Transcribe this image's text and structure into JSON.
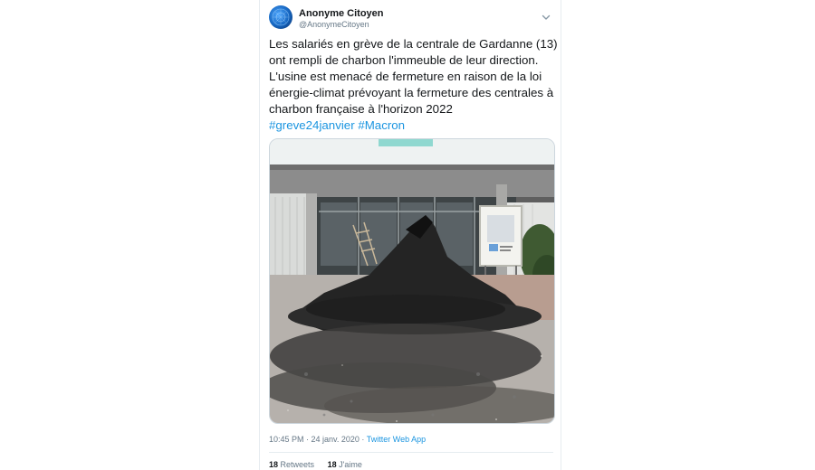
{
  "tweet": {
    "author_name": "Anonyme Citoyen",
    "author_handle": "@AnonymeCitoyen",
    "text_lines": [
      "Les salariés en grève de la centrale de Gardanne (13)",
      "ont rempli de charbon l'immeuble de leur direction.",
      "L'usine est menacé de fermeture en raison de la loi",
      "énergie-climat prévoyant la fermeture des centrales à",
      "charbon française à l'horizon 2022"
    ],
    "hashtags": [
      "#greve24janvier",
      "#Macron"
    ],
    "time": "10:45 PM",
    "separator": " · ",
    "date": "24 janv. 2020",
    "source": "Twitter Web App",
    "retweets_count": "18",
    "retweets_label": "Retweets",
    "likes_count": "18",
    "likes_label": "J'aime"
  },
  "icons": {
    "menu": "chevron-down-icon",
    "avatar": "avatar"
  },
  "colors": {
    "link": "#1b95e0",
    "text": "#14171a",
    "muted": "#657786",
    "border": "#e6ecf0"
  }
}
